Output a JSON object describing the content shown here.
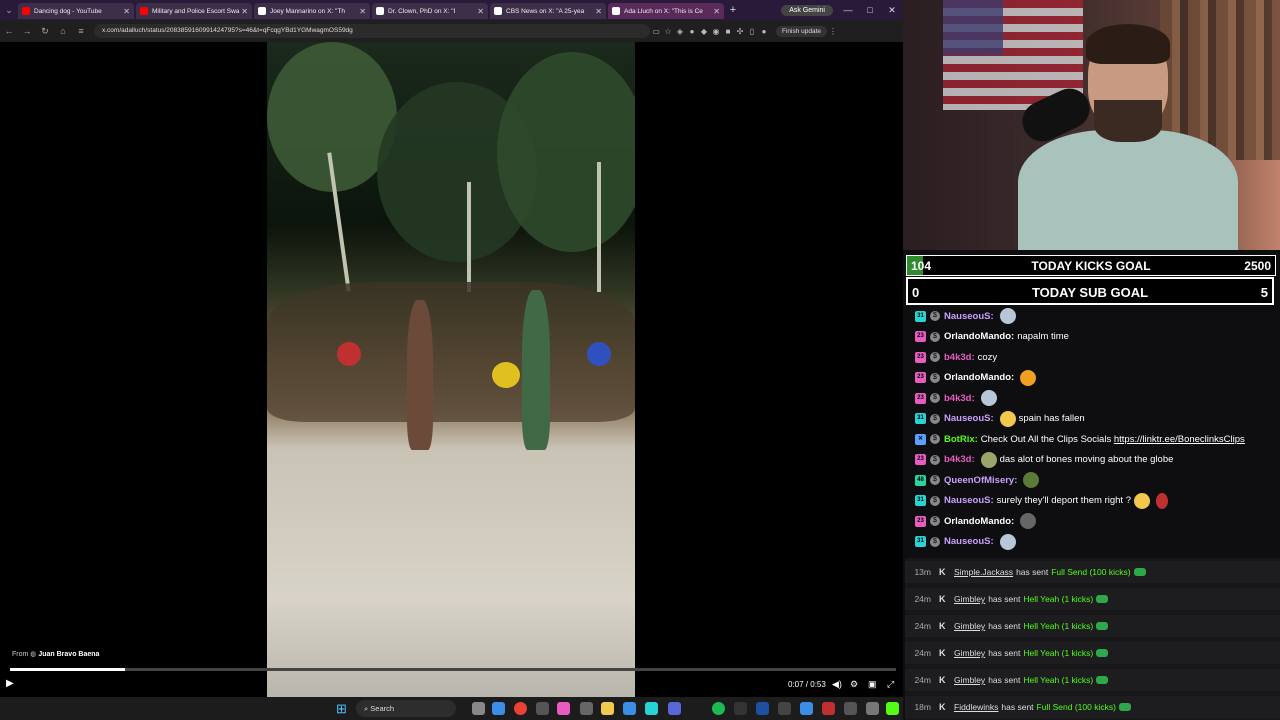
{
  "browser": {
    "tabs": [
      {
        "title": "Dancing dog - YouTube",
        "color": "#ff0000"
      },
      {
        "title": "Military and Police Escort Swa",
        "color": "#ff0000"
      },
      {
        "title": "Joey Mannarino on X: \"Th",
        "color": "#ffffff"
      },
      {
        "title": "Dr. Clown, PhD on X: \"I",
        "color": "#ffffff"
      },
      {
        "title": "CBS News on X: \"A 25-yea",
        "color": "#ffffff"
      },
      {
        "title": "Ada Lluch on X: \"This is Ce",
        "color": "#ffffff"
      }
    ],
    "new_tab": "+",
    "ask_gemini": "Ask Gemini",
    "url": "x.com/adalluch/status/2083859160991424795?s=46&t=qFcqgYBd1YGMwagmOS59dg",
    "finish_update": "Finish update",
    "window_controls": [
      "—",
      "□",
      "✕"
    ]
  },
  "video": {
    "from_label": "From",
    "source": "Juan Bravo Baena",
    "progress": 0.13,
    "time": "0:07 / 0:53"
  },
  "stream": {
    "kicks_goal": {
      "current": "104",
      "title": "TODAY KICKS GOAL",
      "target": "2500",
      "accent": "#2e8b2e"
    },
    "sub_goal": {
      "current": "0",
      "title": "TODAY SUB GOAL",
      "target": "5"
    },
    "chat": [
      {
        "user": "NauseouS:",
        "color": "#c9a0ff",
        "badge": "31",
        "badge_color": "#2ad3d3",
        "emote": "#b8c7d8",
        "text": ""
      },
      {
        "user": "OrlandoMando:",
        "color": "#ffffff",
        "badge": "23",
        "badge_color": "#e85cc2",
        "emote": "",
        "text": "napalm time"
      },
      {
        "user": "b4k3d:",
        "color": "#e85cc2",
        "badge": "23",
        "badge_color": "#e85cc2",
        "emote": "",
        "text": "cozy"
      },
      {
        "user": "OrlandoMando:",
        "color": "#ffffff",
        "badge": "23",
        "badge_color": "#e85cc2",
        "emote": "#f0a020",
        "text": ""
      },
      {
        "user": "b4k3d:",
        "color": "#e85cc2",
        "badge": "23",
        "badge_color": "#e85cc2",
        "emote": "#b8c7d8",
        "text": ""
      },
      {
        "user": "NauseouS:",
        "color": "#c9a0ff",
        "badge": "31",
        "badge_color": "#2ad3d3",
        "emote": "#f2c94c",
        "text": "spain has fallen"
      },
      {
        "user": "BotRix:",
        "color": "#53fc18",
        "badge": "✕",
        "badge_color": "#5aa0ff",
        "emote": "",
        "text": "Check Out All the Clips Socials",
        "link": "https://linktr.ee/BoneclinksClips"
      },
      {
        "user": "b4k3d:",
        "color": "#e85cc2",
        "badge": "23",
        "badge_color": "#e85cc2",
        "emote": "#9aa56a",
        "text": "das alot of bones moving about the globe"
      },
      {
        "user": "QueenOfMisery:",
        "color": "#c9a0ff",
        "badge": "48",
        "badge_color": "#2ad3a0",
        "emote": "#5a7a3a",
        "text": ""
      },
      {
        "user": "NauseouS:",
        "color": "#c9a0ff",
        "badge": "31",
        "badge_color": "#2ad3d3",
        "emote": "",
        "text": "surely they'll deport them right ?",
        "emote_after": "#f2c94c"
      },
      {
        "user": "OrlandoMando:",
        "color": "#ffffff",
        "badge": "23",
        "badge_color": "#e85cc2",
        "emote": "#666666",
        "text": ""
      },
      {
        "user": "NauseouS:",
        "color": "#c9a0ff",
        "badge": "31",
        "badge_color": "#2ad3d3",
        "emote": "#b8c7d8",
        "text": ""
      }
    ],
    "kicks": [
      {
        "ago": "13m",
        "user": "Simple.Jackass",
        "sent": "has sent",
        "msg": "Full Send (100 kicks)"
      },
      {
        "ago": "24m",
        "user": "Gimbley",
        "sent": "has sent",
        "msg": "Hell Yeah (1 kicks)"
      },
      {
        "ago": "24m",
        "user": "Gimbley",
        "sent": "has sent",
        "msg": "Hell Yeah (1 kicks)"
      },
      {
        "ago": "24m",
        "user": "Gimbley",
        "sent": "has sent",
        "msg": "Hell Yeah (1 kicks)"
      },
      {
        "ago": "24m",
        "user": "Gimbley",
        "sent": "has sent",
        "msg": "Hell Yeah (1 kicks)"
      },
      {
        "ago": "18m",
        "user": "Fiddlewinks",
        "sent": "has sent",
        "msg": "Full Send (100 kicks)"
      }
    ]
  },
  "taskbar": {
    "search_label": "Search"
  }
}
